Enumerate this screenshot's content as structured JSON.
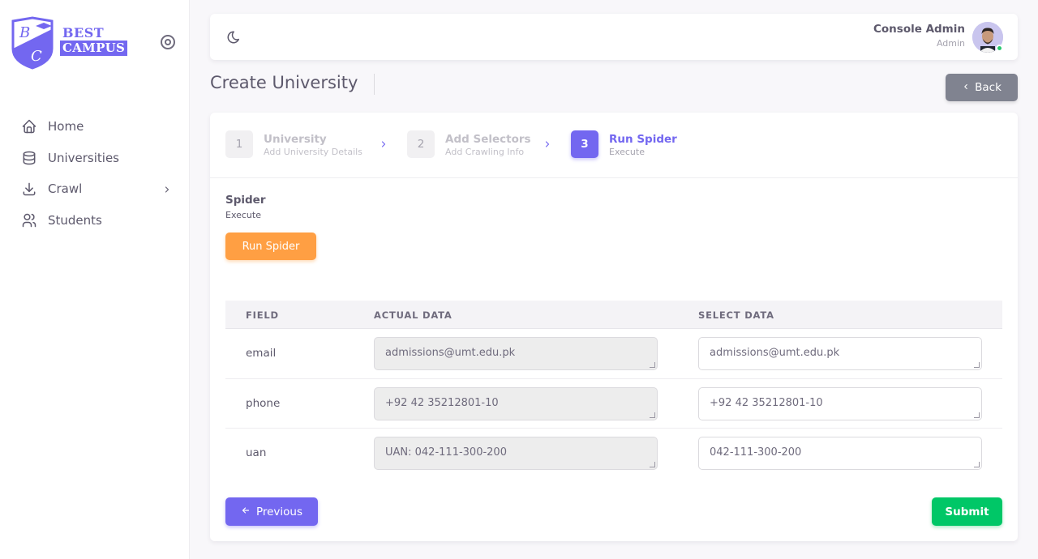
{
  "brand": {
    "line1": "BEST",
    "line2": "CAMPUS"
  },
  "sidebar": {
    "items": [
      {
        "label": "Home",
        "icon": "home-icon"
      },
      {
        "label": "Universities",
        "icon": "database-icon"
      },
      {
        "label": "Crawl",
        "icon": "download-icon",
        "has_submenu": true
      },
      {
        "label": "Students",
        "icon": "users-icon"
      }
    ]
  },
  "navbar": {
    "user_name": "Console Admin",
    "user_role": "Admin"
  },
  "header": {
    "title": "Create University",
    "back_label": "Back"
  },
  "stepper": {
    "steps": [
      {
        "num": "1",
        "title": "University",
        "sub": "Add University Details"
      },
      {
        "num": "2",
        "title": "Add Selectors",
        "sub": "Add Crawling Info"
      },
      {
        "num": "3",
        "title": "Run Spider",
        "sub": "Execute",
        "active": true
      }
    ]
  },
  "section": {
    "title": "Spider",
    "sub": "Execute",
    "run_label": "Run Spider"
  },
  "table": {
    "headers": [
      "FIELD",
      "ACTUAL DATA",
      "SELECT DATA"
    ],
    "rows": [
      {
        "field": "email",
        "actual": "admissions@umt.edu.pk",
        "select": "admissions@umt.edu.pk"
      },
      {
        "field": "phone",
        "actual": "+92 42 35212801-10",
        "select": "+92 42 35212801-10"
      },
      {
        "field": "uan",
        "actual": "UAN: 042-111-300-200",
        "select": "042-111-300-200"
      }
    ]
  },
  "footer": {
    "previous_label": "Previous",
    "submit_label": "Submit"
  },
  "colors": {
    "primary": "#7367f0",
    "warning": "#ff9f43",
    "success": "#00c767",
    "secondary": "#808390"
  }
}
